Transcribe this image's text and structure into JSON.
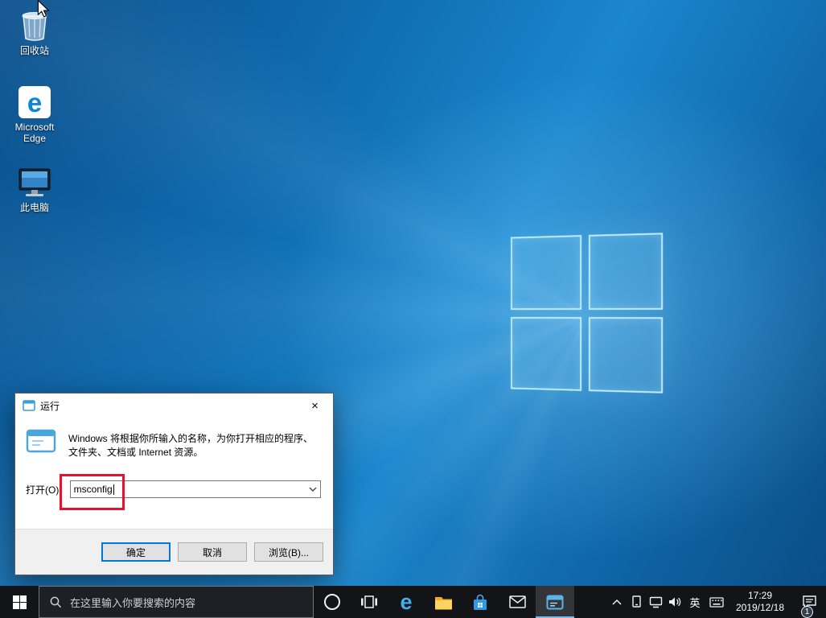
{
  "colors": {
    "accent": "#0078d7",
    "annotation_red": "#e8112d",
    "taskbar_bg": "#121418",
    "wallpaper_blue": "#1a86cd"
  },
  "desktop": {
    "icons": [
      {
        "label": "回收站"
      },
      {
        "label": "Microsoft Edge"
      },
      {
        "label": "此电脑"
      }
    ],
    "edge_glyph": "e"
  },
  "run_dialog": {
    "title": "运行",
    "close_glyph": "×",
    "description": "Windows 将根据你所输入的名称，为你打开相应的程序、文件夹、文档或 Internet 资源。",
    "open_label": "打开(O):",
    "input_value": "msconfig",
    "ok_label": "确定",
    "cancel_label": "取消",
    "browse_label": "浏览(B)..."
  },
  "taskbar": {
    "search_placeholder": "在这里输入你要搜索的内容",
    "edge_glyph": "e",
    "language_indicator": "英",
    "clock_time": "17:29",
    "clock_date": "2019/12/18",
    "notification_badge": "1"
  }
}
